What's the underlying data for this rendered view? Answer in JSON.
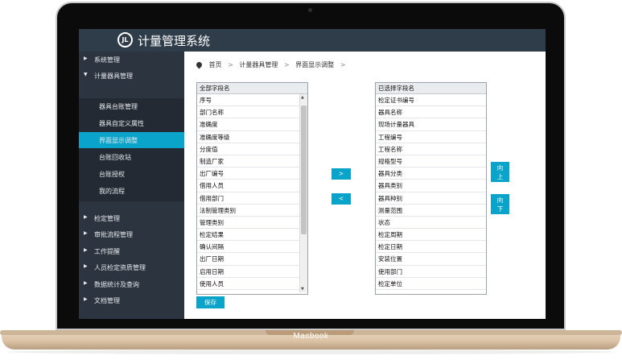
{
  "device": {
    "brand": "Macbook"
  },
  "app": {
    "title": "计量管理系统",
    "logo_text": "JL"
  },
  "sidebar": {
    "items": [
      {
        "label": "系统管理",
        "arrow": "▶"
      },
      {
        "label": "计量器具管理",
        "arrow": "▼"
      },
      {
        "label": "检定管理",
        "arrow": "▶"
      },
      {
        "label": "审批流程管理",
        "arrow": "▶"
      },
      {
        "label": "工作提醒",
        "arrow": "▶"
      },
      {
        "label": "人员检定资质管理",
        "arrow": "▶"
      },
      {
        "label": "数据统计及查询",
        "arrow": "▶"
      },
      {
        "label": "文档管理",
        "arrow": "▶"
      }
    ],
    "subitems": [
      {
        "label": "器具台账管理"
      },
      {
        "label": "器具自定义属性"
      },
      {
        "label": "界面显示调整"
      },
      {
        "label": "台账回收站"
      },
      {
        "label": "台账授权"
      },
      {
        "label": "我的流程"
      }
    ]
  },
  "breadcrumb": {
    "items": [
      "首页",
      "计量器具管理",
      "界面显示调整"
    ],
    "separator": ">"
  },
  "left_list": {
    "header": "全部字段名",
    "rows": [
      "序号",
      "部门名称",
      "准确度",
      "准确度等级",
      "分度值",
      "制造厂家",
      "出厂编号",
      "借用人员",
      "借用部门",
      "法制管理类别",
      "管理类别",
      "检定结果",
      "确认间隔",
      "出厂日期",
      "启用日期",
      "使用人员"
    ]
  },
  "right_list": {
    "header": "已选择字段名",
    "rows": [
      "检定证书编号",
      "器具名称",
      "现场计量器具",
      "工程编号",
      "工程名称",
      "规格型号",
      "器具分类",
      "器具类别",
      "器具种别",
      "测量范围",
      "状态",
      "检定周期",
      "检定日期",
      "安装位置",
      "使用部门",
      "检定单位"
    ]
  },
  "buttons": {
    "add": ">",
    "remove": "<",
    "up_1": "向",
    "up_2": "上",
    "down_1": "向",
    "down_2": "下",
    "save": "保存"
  },
  "colors": {
    "topbar": "#2f3d4a",
    "sidebar": "#2c3440",
    "accent": "#0aa3c9"
  }
}
